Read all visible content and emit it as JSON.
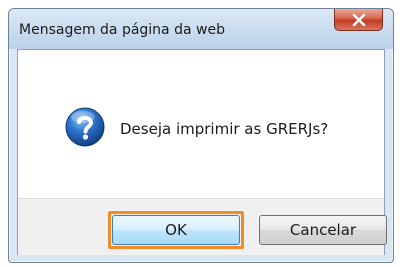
{
  "dialog": {
    "title": "Mensagem da página da web",
    "message": "Deseja imprimir as GRERJs?",
    "icon": "question-icon",
    "buttons": {
      "ok_label": "OK",
      "cancel_label": "Cancelar"
    },
    "close_icon": "close-icon"
  },
  "colors": {
    "highlight": "#f28a26",
    "close_button": "#c23b22",
    "question_icon": "#1f5fb0"
  }
}
